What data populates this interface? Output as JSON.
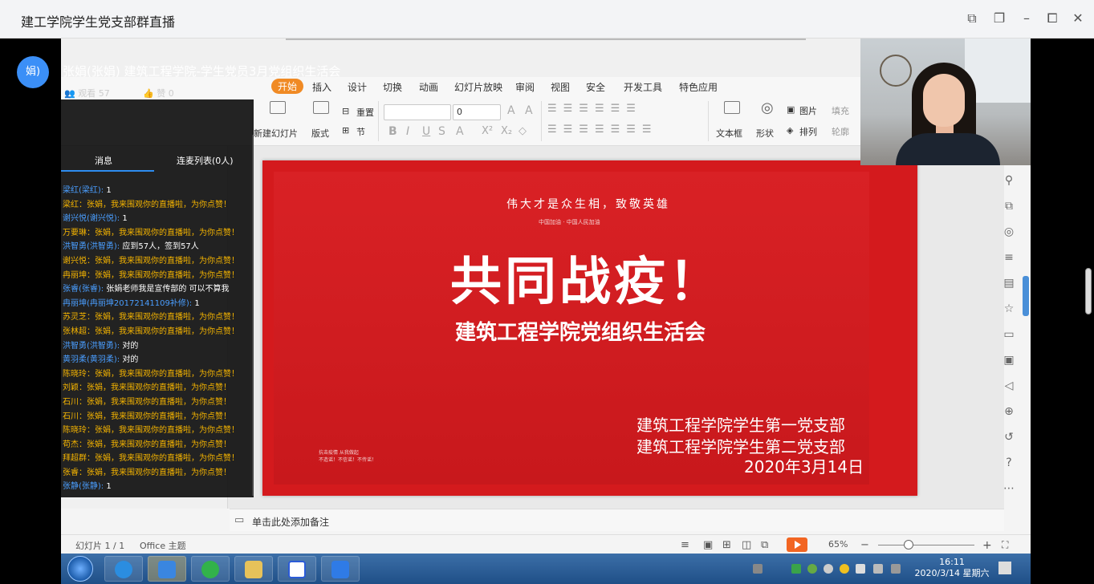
{
  "window": {
    "title": "建工学院学生党支部群直播"
  },
  "host": {
    "avatar_text": "娟)",
    "title": "张娟(张娟) 建筑工程学院-学生党员3月党组织生活会",
    "viewers": "观看 57",
    "likes": "赞 0"
  },
  "chat": {
    "tabs": [
      "消息",
      "连麦列表(0人)"
    ],
    "messages": [
      {
        "name": "梁红(梁红):",
        "text": " 1",
        "highlight": false
      },
      {
        "name": "梁红：",
        "text": "张娟，我来围观你的直播啦，为你点赞！",
        "highlight": true
      },
      {
        "name": "谢兴悦(谢兴悦):",
        "text": " 1",
        "highlight": false
      },
      {
        "name": "万要琳：",
        "text": "张娟，我来围观你的直播啦，为你点赞！",
        "highlight": true
      },
      {
        "name": "洪智勇(洪智勇):",
        "text": " 应到57人，签到57人",
        "highlight": false
      },
      {
        "name": "谢兴悦：",
        "text": "张娟，我来围观你的直播啦，为你点赞！",
        "highlight": true
      },
      {
        "name": "冉丽坤：",
        "text": "张娟，我来围观你的直播啦，为你点赞！",
        "highlight": true
      },
      {
        "name": "张睿(张睿):",
        "text": " 张娟老师我是宣传部的 可以不算我",
        "highlight": false
      },
      {
        "name": "冉丽坤(冉丽坤20172141109补修):",
        "text": " 1",
        "highlight": false
      },
      {
        "name": "苏灵芝：",
        "text": "张娟，我来围观你的直播啦，为你点赞！",
        "highlight": true
      },
      {
        "name": "张林超：",
        "text": "张娟，我来围观你的直播啦，为你点赞！",
        "highlight": true
      },
      {
        "name": "洪智勇(洪智勇):",
        "text": " 对的",
        "highlight": false
      },
      {
        "name": "黄羽柔(黄羽柔):",
        "text": " 对的",
        "highlight": false
      },
      {
        "name": "陈晓玲：",
        "text": "张娟，我来围观你的直播啦，为你点赞！",
        "highlight": true
      },
      {
        "name": "刘颖：",
        "text": "张娟，我来围观你的直播啦，为你点赞！",
        "highlight": true
      },
      {
        "name": "石川：",
        "text": "张娟，我来围观你的直播啦，为你点赞！",
        "highlight": true
      },
      {
        "name": "石川：",
        "text": "张娟，我来围观你的直播啦，为你点赞！",
        "highlight": true
      },
      {
        "name": "陈晓玲：",
        "text": "张娟，我来围观你的直播啦，为你点赞！",
        "highlight": true
      },
      {
        "name": "苟杰：",
        "text": "张娟，我来围观你的直播啦，为你点赞！",
        "highlight": true
      },
      {
        "name": "拜超群：",
        "text": "张娟，我来围观你的直播啦，为你点赞！",
        "highlight": true
      },
      {
        "name": "张睿：",
        "text": "张娟，我来围观你的直播啦，为你点赞！",
        "highlight": true
      },
      {
        "name": "张静(张静):",
        "text": " 1",
        "highlight": false
      }
    ]
  },
  "ppt": {
    "menu": [
      "开始",
      "插入",
      "设计",
      "切换",
      "动画",
      "幻灯片放映",
      "审阅",
      "视图",
      "安全",
      "开发工具",
      "特色应用"
    ],
    "ribbon": {
      "new_slide": "新建幻灯片",
      "layout": "版式",
      "reset": "重置",
      "section": "节",
      "font_size": "0",
      "textbox": "文本框",
      "shape": "形状",
      "picture": "图片",
      "arrange": "排列",
      "fill": "填充",
      "outline": "轮廓"
    },
    "slide": {
      "banner": "伟大才是众生相，致敬英雄",
      "subbanner": "中国加油 · 中国人民加油",
      "title": "共同战疫！",
      "subtitle": "建筑工程学院党组织生活会",
      "branch1": "建筑工程学院学生第一党支部",
      "branch2": "建筑工程学院学生第二党支部",
      "date": "2020年3月14日",
      "small_note_1": "抗击疫情 从我做起",
      "small_note_2": "不造谣！不信谣！不传谣！"
    },
    "notes_placeholder": "单击此处添加备注",
    "status": {
      "slide_counter": "幻灯片 1 / 1",
      "theme": "Office 主题",
      "zoom": "65%"
    }
  },
  "taskbar": {
    "time": "16:11",
    "date": "2020/3/14 星期六"
  },
  "colors": {
    "slide_red": "#d41a1d",
    "accent_orange": "#f08a24",
    "chat_highlight": "#f5b400",
    "chat_name": "#4a9eff"
  }
}
